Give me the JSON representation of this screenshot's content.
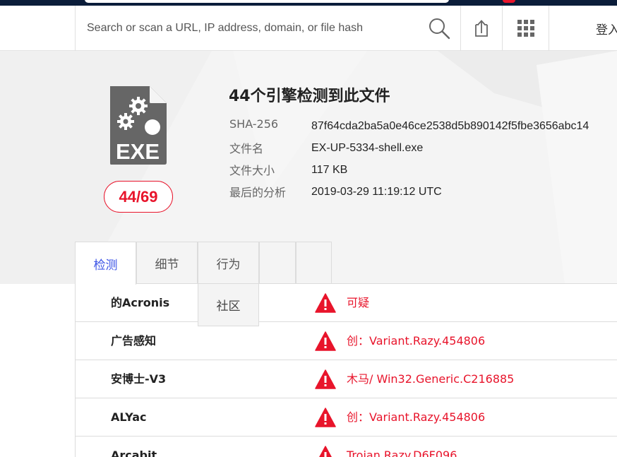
{
  "search": {
    "placeholder": "Search or scan a URL, IP address, domain, or file hash"
  },
  "header": {
    "login_label": "登入"
  },
  "icons": {
    "search": "search-icon",
    "upload": "upload-icon",
    "apps": "apps-grid-icon",
    "file": "exe-file-icon",
    "warning": "warning-icon"
  },
  "colors": {
    "accent_red": "#e8142b",
    "active_tab_blue": "#3b53e6",
    "icon_gray": "#666666",
    "header_dark": "#0b1d3a"
  },
  "file": {
    "icon_text": "EXE",
    "title": "44个引擎检测到此文件",
    "score": "44/69",
    "details": [
      {
        "label": "SHA-256",
        "value": "87f64cda2ba5a0e46ce2538d5b890142f5fbe3656abc14"
      },
      {
        "label": "文件名",
        "value": "EX-UP-5334-shell.exe"
      },
      {
        "label": "文件大小",
        "value": "117 KB"
      },
      {
        "label": "最后的分析",
        "value": "2019-03-29 11:19:12 UTC"
      }
    ]
  },
  "tabs": [
    {
      "label": "检测",
      "active": true
    },
    {
      "label": "细节",
      "active": false
    },
    {
      "label": "行为",
      "active": false
    },
    {
      "label": "",
      "active": false
    },
    {
      "label": "",
      "active": false
    }
  ],
  "dropdown": {
    "item": "社区"
  },
  "results": [
    {
      "engine": "的Acronis",
      "verdict": "可疑"
    },
    {
      "engine": "广告感知",
      "verdict": "创：Variant.Razy.454806"
    },
    {
      "engine": "安博士-V3",
      "verdict": "木马/ Win32.Generic.C216885"
    },
    {
      "engine": "ALYac",
      "verdict": "创：Variant.Razy.454806"
    },
    {
      "engine": "Arcabit",
      "verdict": "Trojan.Razy.D6F096"
    }
  ]
}
